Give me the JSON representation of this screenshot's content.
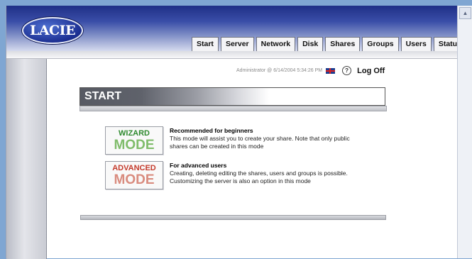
{
  "header": {
    "logo_text": "LACIE",
    "tabs": [
      "Start",
      "Server",
      "Network",
      "Disk",
      "Shares",
      "Groups",
      "Users",
      "Status"
    ]
  },
  "userbar": {
    "user_info": "Administrator @ 6/14/2004 5:34:26 PM",
    "help_glyph": "?",
    "logoff_label": "Log Off"
  },
  "page": {
    "title": "START"
  },
  "modes": {
    "wizard": {
      "line1": "WIZARD",
      "line2": "MODE",
      "heading": "Recommended for beginners",
      "description": "This mode will assist you to create your share. Note that only public shares can be created in this mode"
    },
    "advanced": {
      "line1": "ADVANCED",
      "line2": "MODE",
      "heading": "For advanced users",
      "description": "Creating, deleting editing the shares, users and groups is possible. Customizing the server is also an option in this mode"
    }
  },
  "colors": {
    "header_dark": "#1f2f86",
    "wizard_green": "#2e8a2e",
    "advanced_red": "#c43a2b"
  }
}
